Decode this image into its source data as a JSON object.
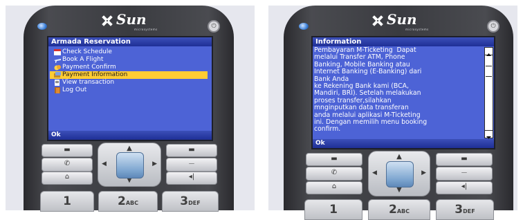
{
  "left_phone": {
    "brand": "Sun",
    "brand_sub": "microsystems",
    "screen_title": "Armada Reservation",
    "menu_items": [
      {
        "label": "Check Schedule",
        "icon": "calendar-icon",
        "selected": false
      },
      {
        "label": "Book A Flight",
        "icon": "plane-icon",
        "selected": false
      },
      {
        "label": "Payment Confirm",
        "icon": "payment-icon",
        "selected": false
      },
      {
        "label": "Payment Information",
        "icon": "info-icon",
        "selected": true
      },
      {
        "label": "View transaction",
        "icon": "document-icon",
        "selected": false
      },
      {
        "label": "Log Out",
        "icon": "door-icon",
        "selected": false
      }
    ],
    "softkey": "Ok",
    "keys": {
      "k1": "1",
      "k2": "2",
      "k2_letters": "ABC",
      "k3": "3",
      "k3_letters": "DEF"
    }
  },
  "right_phone": {
    "brand": "Sun",
    "brand_sub": "microsystems",
    "screen_title": "Information",
    "info_lines": [
      "Pembayaran M-Ticketing  Dapat",
      "melalui Transfer ATM, Phone",
      "Banking, Mobile Banking atau",
      "Internet Banking (E-Banking) dari",
      "Bank Anda",
      "ke Rekening Bank kami (BCA,",
      "Mandiri, BRI). Setelah melakukan",
      "proses transfer,silahkan",
      "mnginputkan data transferan",
      "anda melalui aplikasi M-Ticketing",
      "ini. Dengan memilih menu booking",
      "confirm."
    ],
    "softkey": "Ok",
    "keys": {
      "k1": "1",
      "k2": "2",
      "k2_letters": "ABC",
      "k3": "3",
      "k3_letters": "DEF"
    }
  },
  "colors": {
    "title_bar": "#1f2f96",
    "screen_bg": "#4d63d6",
    "selection": "#ffcc33",
    "phone_body": "#3a3b40"
  }
}
